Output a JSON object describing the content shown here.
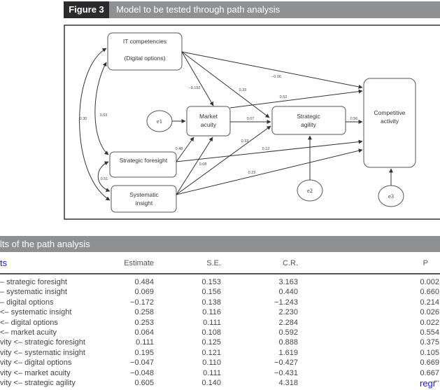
{
  "figure": {
    "label": "Figure 3",
    "title": "Model to be tested through path analysis",
    "nodes": {
      "it": [
        "IT competencies",
        "(Digital options)"
      ],
      "market": [
        "Market",
        "acuity"
      ],
      "agility": [
        "Strategic",
        "agility"
      ],
      "competitive": [
        "Competitive",
        "activity"
      ],
      "foresight": [
        "Strategic foresight"
      ],
      "systematic": [
        "Systematic",
        "insight"
      ],
      "e1": "e1",
      "e2": "e2",
      "e3": "e3"
    },
    "edge_labels": {
      "it_comp": "−0.06",
      "it_market": "−0.192",
      "it_agility": "0.33",
      "market_comp": "0.52",
      "corr_it_sys": "0.30",
      "corr_it_fore": "0.53",
      "market_agility": "0.07",
      "agility_comp": "0.56",
      "sys_agility": "0.33",
      "fore_market": "0.48",
      "fore_comp": "0.12",
      "sys_market": "0.08",
      "sys_comp": "0.23",
      "corr_fore_sys": "0.51"
    }
  },
  "table": {
    "title": "lts of the path analysis",
    "first_col_header": "ts",
    "headers": [
      "Estimate",
      "S.E.",
      "C.R.",
      "P"
    ],
    "rows": [
      [
        "– strategic foresight",
        "0.484",
        "0.153",
        "3.163",
        "0.002"
      ],
      [
        "– systematic insight",
        "0.069",
        "0.156",
        "0.440",
        "0.660"
      ],
      [
        "– digital options",
        "−0.172",
        "0.138",
        "−1.243",
        "0.214"
      ],
      [
        "<– systematic insight",
        "0.258",
        "0.116",
        "2.230",
        "0.026"
      ],
      [
        "<– digital options",
        "0.253",
        "0.111",
        "2.284",
        "0.022"
      ],
      [
        "<– market acuity",
        "0.064",
        "0.108",
        "0.592",
        "0.554"
      ],
      [
        "vity <– strategic foresight",
        "0.111",
        "0.125",
        "0.888",
        "0.375"
      ],
      [
        "vity <– systematic insight",
        "0.195",
        "0.121",
        "1.619",
        "0.105"
      ],
      [
        "vity <– digital options",
        "−0.047",
        "0.110",
        "−0.427",
        "0.669"
      ],
      [
        "vity <– market acuity",
        "−0.048",
        "0.111",
        "−0.431",
        "0.667"
      ],
      [
        "vity <– strategic agility",
        "0.605",
        "0.140",
        "4.318",
        "***"
      ]
    ],
    "footer_link": "regr"
  }
}
